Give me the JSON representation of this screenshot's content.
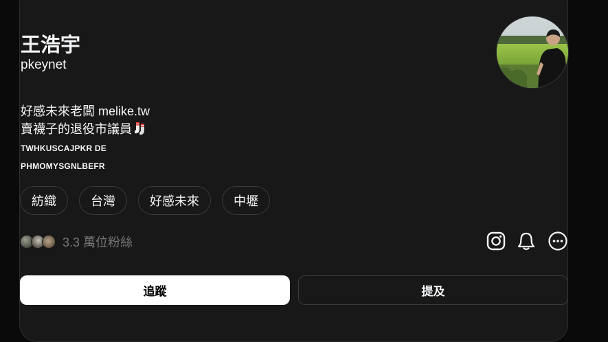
{
  "profile": {
    "name": "王浩宇",
    "handle": "pkeynet",
    "bio_line1": "好感未來老闆 melike.tw",
    "bio_line2": "賣襪子的退役市議員",
    "bio_emoji": "socks-emoji",
    "code_line1": "TWHKUSCAJPKR DE",
    "code_line2": "PHMOMYSGNLBEFR"
  },
  "tags": [
    "紡織",
    "台灣",
    "好感未來",
    "中壢"
  ],
  "followers": {
    "text": "3.3 萬位粉絲"
  },
  "icons": {
    "instagram": "instagram-icon",
    "notifications": "bell-icon",
    "more": "more-options-icon"
  },
  "buttons": {
    "follow_label": "追蹤",
    "mention_label": "提及"
  },
  "colors": {
    "background": "#0a0a0a",
    "card": "#181818",
    "border": "#2d2d2d",
    "text": "#f3f5f7",
    "muted": "#777777",
    "follow_bg": "#ffffff"
  }
}
